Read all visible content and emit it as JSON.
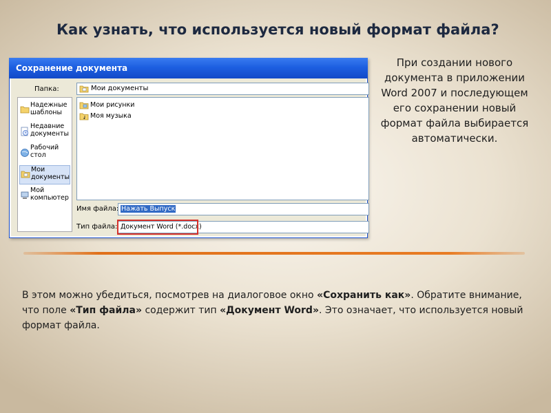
{
  "slide": {
    "title": "Как узнать, что используется новый формат файла?",
    "side_text": "При создании нового документа в приложении Word 2007 и последующем его сохранении новый формат файла выбирается автоматически."
  },
  "dialog": {
    "title": "Сохранение документа",
    "folder_label": "Папка:",
    "folder_value": "Мои документы",
    "places": [
      {
        "label": "Надежные шаблоны",
        "icon": "folder-icon"
      },
      {
        "label": "Недавние документы",
        "icon": "recent-documents-icon"
      },
      {
        "label": "Рабочий стол",
        "icon": "desktop-icon"
      },
      {
        "label": "Мои документы",
        "icon": "my-documents-icon"
      },
      {
        "label": "Мой компьютер",
        "icon": "computer-icon"
      }
    ],
    "files": [
      {
        "label": "Мои рисунки",
        "icon": "pictures-folder-icon"
      },
      {
        "label": "Моя музыка",
        "icon": "music-folder-icon"
      }
    ],
    "filename_label": "Имя файла:",
    "filename_value": "Нажать Выпуск",
    "filetype_label": "Тип файла:",
    "filetype_value": "Документ Word (*.docx)",
    "highlight_color": "#d6302a"
  },
  "bottom": {
    "part1": "В этом можно убедиться, посмотрев на диалоговое окно ",
    "bold1": "«Сохранить как»",
    "part2": ". Обратите внимание, что поле ",
    "bold2": "«Тип файла»",
    "part3": " содержит тип ",
    "bold3": "«Документ Word»",
    "part4": ". Это означает, что используется новый формат файла."
  },
  "colors": {
    "titlebar": "#1d5fe1",
    "divider": "#e0701a",
    "title_text": "#1d2940"
  }
}
